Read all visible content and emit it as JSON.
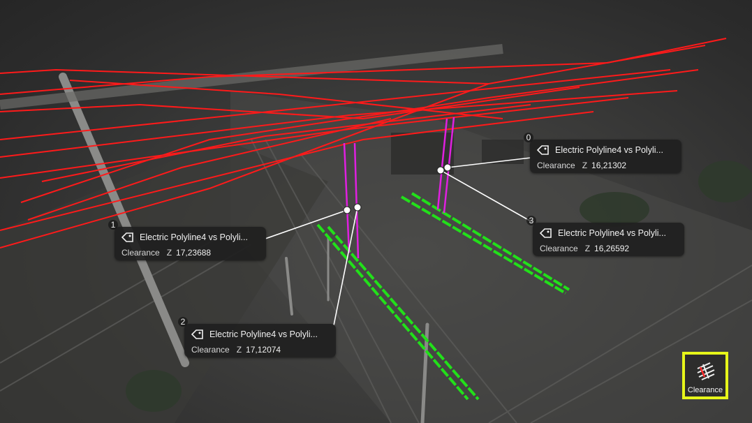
{
  "labels": [
    {
      "index": "0",
      "title": "Electric Polyline4 vs Polyli...",
      "metric": "Clearance",
      "axis": "Z",
      "value": "16,21302"
    },
    {
      "index": "1",
      "title": "Electric Polyline4 vs Polyli...",
      "metric": "Clearance",
      "axis": "Z",
      "value": "17,23688"
    },
    {
      "index": "2",
      "title": "Electric Polyline4 vs Polyli...",
      "metric": "Clearance",
      "axis": "Z",
      "value": "17,12074"
    },
    {
      "index": "3",
      "title": "Electric Polyline4 vs Polyli...",
      "metric": "Clearance",
      "axis": "Z",
      "value": "16,26592"
    }
  ],
  "tool": {
    "label": "Clearance",
    "icon": "clearance-icon",
    "highlight": "#e6f51a"
  },
  "colors": {
    "wires": "#ff1a1a",
    "rails": "#22e01a",
    "clearance_lines": "#e020e0"
  }
}
